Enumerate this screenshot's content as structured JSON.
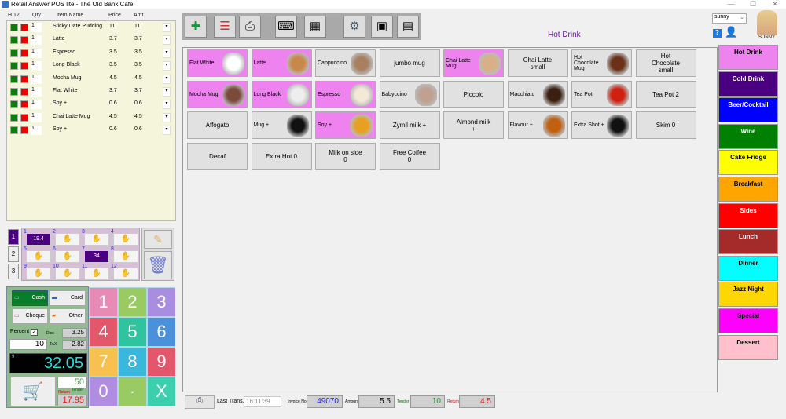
{
  "window": {
    "title": "Retail Answer POS lite - The Old Bank Cafe",
    "min": "—",
    "max": "☐",
    "close": "✕"
  },
  "order": {
    "headers": {
      "table": "H 12",
      "qty": "Qty",
      "item": "Item Name",
      "price": "Price",
      "amt": "Amt."
    },
    "rows": [
      {
        "qty": "1",
        "item": "Sticky Date Pudding",
        "price": "11",
        "amt": "11"
      },
      {
        "qty": "1",
        "item": "Latte",
        "price": "3.7",
        "amt": "3.7"
      },
      {
        "qty": "1",
        "item": "Espresso",
        "price": "3.5",
        "amt": "3.5"
      },
      {
        "qty": "1",
        "item": "Long Black",
        "price": "3.5",
        "amt": "3.5"
      },
      {
        "qty": "1",
        "item": "Mocha Mug",
        "price": "4.5",
        "amt": "4.5"
      },
      {
        "qty": "1",
        "item": "Flat White",
        "price": "3.7",
        "amt": "3.7"
      },
      {
        "qty": "1",
        "item": "Soy +",
        "price": "0.6",
        "amt": "0.6"
      },
      {
        "qty": "1",
        "item": "Chai Latte Mug",
        "price": "4.5",
        "amt": "4.5"
      },
      {
        "qty": "1",
        "item": "Soy +",
        "price": "0.6",
        "amt": "0.6"
      }
    ]
  },
  "hold": {
    "tabs": [
      "1",
      "2",
      "3"
    ],
    "slots": [
      {
        "n": "1",
        "v": "19.4"
      },
      {
        "n": "2",
        "v": ""
      },
      {
        "n": "3",
        "v": ""
      },
      {
        "n": "4",
        "v": ""
      },
      {
        "n": "5",
        "v": ""
      },
      {
        "n": "6",
        "v": ""
      },
      {
        "n": "7",
        "v": "34"
      },
      {
        "n": "8",
        "v": ""
      },
      {
        "n": "9",
        "v": ""
      },
      {
        "n": "10",
        "v": ""
      },
      {
        "n": "11",
        "v": ""
      },
      {
        "n": "12",
        "v": ""
      }
    ]
  },
  "payment": {
    "cash": "Cash",
    "card": "Card",
    "cheque": "Cheque",
    "other": "Other",
    "percent_label": "Percent",
    "percent_checked": true,
    "percent_value": "10",
    "disc_label": "Disc",
    "disc": "3.25",
    "tax_label": "TAX",
    "tax": "2.82",
    "item_count": "9",
    "total": "32.05",
    "tender": "50",
    "tender_label": "Tender",
    "return_label": "Return",
    "return": "17.95"
  },
  "keypad": [
    {
      "k": "1",
      "c": "#e58bb5"
    },
    {
      "k": "2",
      "c": "#9acb63"
    },
    {
      "k": "3",
      "c": "#a98de0"
    },
    {
      "k": "4",
      "c": "#e2586a"
    },
    {
      "k": "5",
      "c": "#2fc49f"
    },
    {
      "k": "6",
      "c": "#4a90da"
    },
    {
      "k": "7",
      "c": "#f6c14f"
    },
    {
      "k": "8",
      "c": "#3ab7dc"
    },
    {
      "k": "9",
      "c": "#e3566b"
    },
    {
      "k": "0",
      "c": "#b08de0"
    },
    {
      "k": "·",
      "c": "#9acb63"
    },
    {
      "k": "X",
      "c": "#3ccfae"
    }
  ],
  "toolbar": [
    {
      "name": "add-icon",
      "g": "✚"
    },
    {
      "name": "clipboard-icon",
      "g": "☰"
    },
    {
      "name": "printer-icon",
      "g": "⎙"
    },
    {
      "name": "keyboard-icon",
      "g": "⌨"
    },
    {
      "name": "calculator-icon",
      "g": "▦"
    },
    {
      "name": "gear-icon",
      "g": "⚙"
    },
    {
      "name": "box-icon",
      "g": "▣"
    },
    {
      "name": "report-icon",
      "g": "▤"
    }
  ],
  "header": {
    "category_title": "Hot Drink",
    "user_select": "sunny",
    "user_name": "SUNNY"
  },
  "products": [
    {
      "l": "Flat White",
      "pink": true,
      "img": "#fff"
    },
    {
      "l": "Latte",
      "pink": true,
      "img": "#c8884a"
    },
    {
      "l": "Cappuccino",
      "pink": false,
      "img": "#a88060"
    },
    {
      "l": "jumbo mug",
      "pink": false
    },
    {
      "l": "Chai Latte Mug",
      "pink": true,
      "img": "#d8b088"
    },
    {
      "l": "Chai Latte small",
      "pink": false
    },
    {
      "l": "Hot Chocolate Mug",
      "pink": false,
      "img": "#6a3018"
    },
    {
      "l": "Hot Chocolate small",
      "pink": false
    },
    {
      "l": "Mocha Mug",
      "pink": true,
      "img": "#7a4a3a"
    },
    {
      "l": "Long Black",
      "pink": true,
      "img": "#eee"
    },
    {
      "l": "Espresso",
      "pink": true,
      "img": "#f4e8d8"
    },
    {
      "l": "Babyccino",
      "pink": false,
      "img": "#c0a090"
    },
    {
      "l": "Piccolo",
      "pink": false
    },
    {
      "l": "Macchiato",
      "pink": false,
      "img": "#3a2010"
    },
    {
      "l": "Tea Pot",
      "pink": false,
      "img": "#d02010"
    },
    {
      "l": "Tea Pot 2",
      "pink": false
    },
    {
      "l": "Affogato",
      "pink": false
    },
    {
      "l": "Mug +",
      "pink": false,
      "img": "#111"
    },
    {
      "l": "Soy +",
      "pink": true,
      "img": "#e8a020"
    },
    {
      "l": "Zymil milk +",
      "pink": false
    },
    {
      "l": "Almond milk +",
      "pink": false
    },
    {
      "l": "Flavour +",
      "pink": false,
      "img": "#c06010"
    },
    {
      "l": "Extra Shot +",
      "pink": false,
      "img": "#111"
    },
    {
      "l": "Skim 0",
      "pink": false
    },
    {
      "l": "Decaf",
      "pink": false
    },
    {
      "l": "Extra Hot 0",
      "pink": false
    },
    {
      "l": "Milk on side 0",
      "pink": false
    },
    {
      "l": "Free Coffee 0",
      "pink": false
    }
  ],
  "categories": [
    {
      "l": "Hot Drink",
      "bg": "#ee82ee",
      "fg": "#000"
    },
    {
      "l": "Cold Drink",
      "bg": "#4b0082",
      "fg": "#fff"
    },
    {
      "l": "Beer/Cocktail",
      "bg": "#0000ff",
      "fg": "#fff"
    },
    {
      "l": "Wine",
      "bg": "#008000",
      "fg": "#fff"
    },
    {
      "l": "Cake Fridge",
      "bg": "#ffff00",
      "fg": "#000"
    },
    {
      "l": "Breakfast",
      "bg": "#ffa500",
      "fg": "#000"
    },
    {
      "l": "Sides",
      "bg": "#ff0000",
      "fg": "#fff"
    },
    {
      "l": "Lunch",
      "bg": "#a52a2a",
      "fg": "#fff"
    },
    {
      "l": "Dinner",
      "bg": "#00ffff",
      "fg": "#000"
    },
    {
      "l": "Jazz Night",
      "bg": "#ffd700",
      "fg": "#000"
    },
    {
      "l": "Special",
      "bg": "#ff00ff",
      "fg": "#000"
    },
    {
      "l": "Dessert",
      "bg": "#ffc0cb",
      "fg": "#000"
    }
  ],
  "bottom": {
    "last_trans_label": "Last Trans.",
    "last_trans_time": "16:11:39",
    "invoice_label": "Invoice No.",
    "invoice": "49070",
    "amount_label": "Amount",
    "amount": "5.5",
    "tender_label": "Tender",
    "tender": "10",
    "return_label": "Return",
    "return": "4.5"
  }
}
